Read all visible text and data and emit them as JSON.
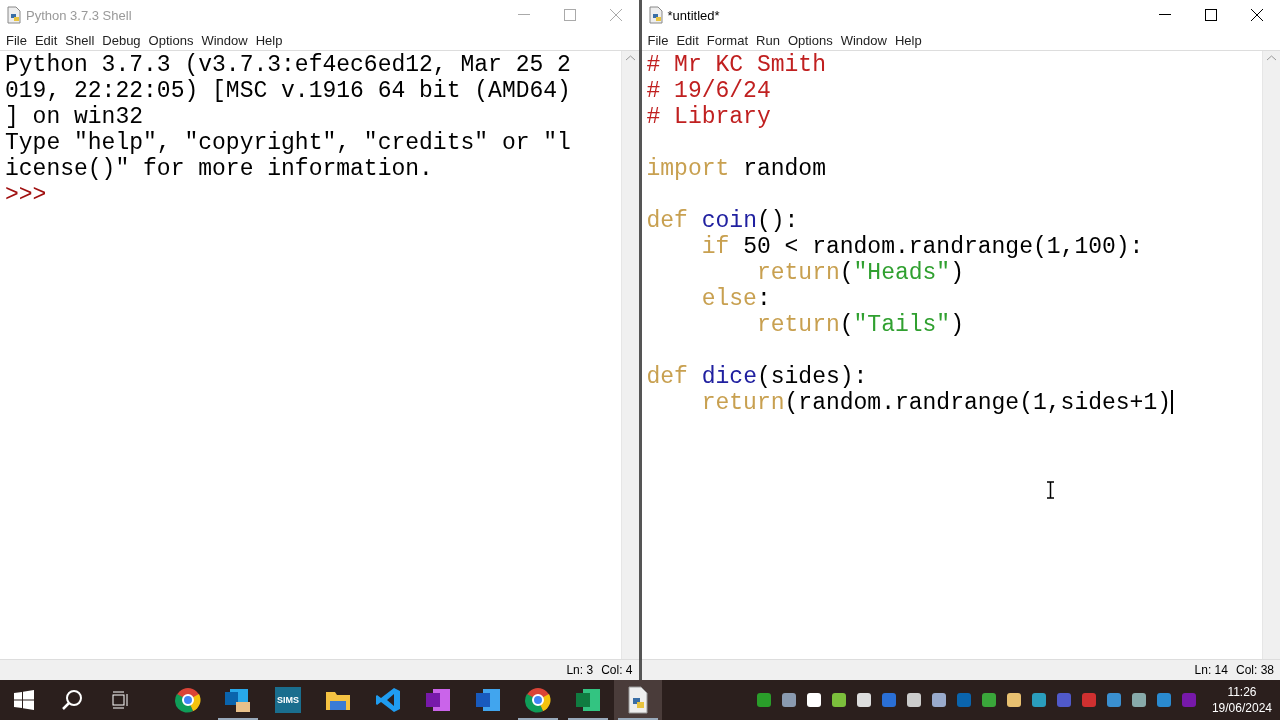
{
  "windows": [
    {
      "title": "Python 3.7.3 Shell",
      "active": false,
      "menu": [
        "File",
        "Edit",
        "Shell",
        "Debug",
        "Options",
        "Window",
        "Help"
      ],
      "lines": [
        {
          "segments": [
            {
              "kind": "output",
              "text": "Python 3.7.3 (v3.7.3:ef4ec6ed12, Mar 25 2"
            }
          ]
        },
        {
          "segments": [
            {
              "kind": "output",
              "text": "019, 22:22:05) [MSC v.1916 64 bit (AMD64)"
            }
          ]
        },
        {
          "segments": [
            {
              "kind": "output",
              "text": "] on win32"
            }
          ]
        },
        {
          "segments": [
            {
              "kind": "output",
              "text": "Type \"help\", \"copyright\", \"credits\" or \"l"
            }
          ]
        },
        {
          "segments": [
            {
              "kind": "output",
              "text": "icense()\" for more information."
            }
          ]
        },
        {
          "segments": [
            {
              "kind": "prompt",
              "text": ">>>"
            }
          ]
        }
      ],
      "caret": false,
      "status": {
        "line": "Ln: 3",
        "col": "Col: 4"
      }
    },
    {
      "title": "*untitled*",
      "active": true,
      "menu": [
        "File",
        "Edit",
        "Format",
        "Run",
        "Options",
        "Window",
        "Help"
      ],
      "lines": [
        {
          "segments": [
            {
              "kind": "comment",
              "text": "# Mr KC Smith"
            }
          ]
        },
        {
          "segments": [
            {
              "kind": "comment",
              "text": "# 19/6/24"
            }
          ]
        },
        {
          "segments": [
            {
              "kind": "comment",
              "text": "# Library"
            }
          ]
        },
        {
          "kind": "blank"
        },
        {
          "segments": [
            {
              "kind": "keyword",
              "text": "import"
            },
            {
              "kind": "plain",
              "text": " random"
            }
          ]
        },
        {
          "kind": "blank"
        },
        {
          "segments": [
            {
              "kind": "keyword",
              "text": "def"
            },
            {
              "kind": "name",
              "text": " coin"
            },
            {
              "kind": "plain",
              "text": "():"
            }
          ]
        },
        {
          "segments": [
            {
              "kind": "keyword",
              "text": "    if"
            },
            {
              "kind": "plain",
              "text": " 50 < random.randrange(1,100):"
            }
          ]
        },
        {
          "segments": [
            {
              "kind": "keyword",
              "text": "        return"
            },
            {
              "kind": "plain",
              "text": "("
            },
            {
              "kind": "string",
              "text": "\"Heads\""
            },
            {
              "kind": "plain",
              "text": ")"
            }
          ]
        },
        {
          "segments": [
            {
              "kind": "keyword",
              "text": "    else"
            },
            {
              "kind": "plain",
              "text": ":"
            }
          ]
        },
        {
          "segments": [
            {
              "kind": "keyword",
              "text": "        return"
            },
            {
              "kind": "plain",
              "text": "("
            },
            {
              "kind": "string",
              "text": "\"Tails\""
            },
            {
              "kind": "plain",
              "text": ")"
            }
          ]
        },
        {
          "kind": "blank"
        },
        {
          "segments": [
            {
              "kind": "keyword",
              "text": "def"
            },
            {
              "kind": "name",
              "text": " dice"
            },
            {
              "kind": "plain",
              "text": "(sides):"
            }
          ]
        },
        {
          "segments": [
            {
              "kind": "keyword",
              "text": "    return"
            },
            {
              "kind": "plain",
              "text": "(random.randrange(1,sides+1)"
            }
          ]
        }
      ],
      "caret": true,
      "status": {
        "line": "Ln: 14",
        "col": "Col: 38"
      }
    }
  ],
  "taskbar": {
    "apps": [
      {
        "kind": "browser",
        "selected": false
      },
      {
        "kind": "mail",
        "selected": true
      },
      {
        "kind": "sims",
        "label": "SIMS",
        "selected": false
      },
      {
        "kind": "folder",
        "selected": false
      },
      {
        "kind": "code",
        "selected": false
      },
      {
        "kind": "notes",
        "selected": false
      },
      {
        "kind": "word",
        "selected": false
      },
      {
        "kind": "browser",
        "selected": true
      },
      {
        "kind": "sheet",
        "selected": true
      },
      {
        "kind": "python",
        "selected": true
      }
    ],
    "time": "11:26",
    "date": "19/06/2024"
  }
}
